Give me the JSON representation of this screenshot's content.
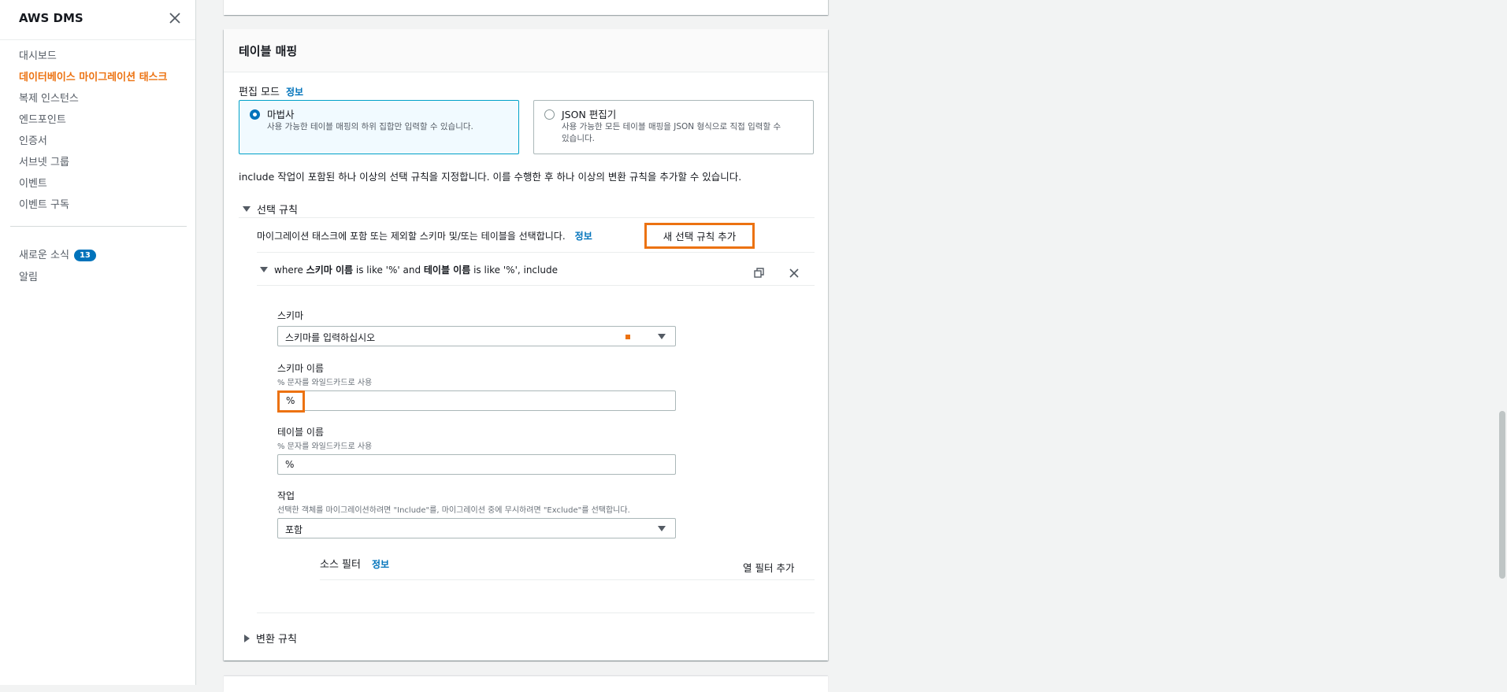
{
  "sidebar": {
    "title": "AWS DMS",
    "items": [
      {
        "label": "대시보드"
      },
      {
        "label": "데이터베이스 마이그레이션 태스크"
      },
      {
        "label": "복제 인스턴스"
      },
      {
        "label": "엔드포인트"
      },
      {
        "label": "인증서"
      },
      {
        "label": "서브넷 그룹"
      },
      {
        "label": "이벤트"
      },
      {
        "label": "이벤트 구독"
      }
    ],
    "whats_new": {
      "label": "새로운 소식",
      "count": "13"
    },
    "notifications": {
      "label": "알림"
    }
  },
  "panel": {
    "title": "테이블 매핑",
    "edit_mode": {
      "label": "편집 모드",
      "info": "정보"
    },
    "tiles": [
      {
        "label": "마법사",
        "desc": "사용 가능한 테이블 매핑의 하위 집합만 입력할 수 있습니다."
      },
      {
        "label": "JSON 편집기",
        "desc_line1": "사용 가능한 모든 테이블 매핑을 JSON 형식으로 직접 입력할 수",
        "desc_line2": "있습니다."
      }
    ],
    "instructions": "include 작업이 포함된 하나 이상의 선택 규칙을 지정합니다. 이를 수행한 후 하나 이상의 변환 규칙을 추가할 수 있습니다.",
    "selection_rules": {
      "title": "선택 규칙",
      "description": "마이그레이션 태스크에 포함 또는 제외할 스키마 및/또는 테이블을 선택합니다.",
      "info": "정보",
      "add_button": "새 선택 규칙 추가",
      "rule": {
        "summary_prefix": "where ",
        "schema_name_bold": "스키마 이름",
        "summary_mid1": " is like '%' and ",
        "table_name_bold": "테이블 이름",
        "summary_mid2": " is like '%', include",
        "schema": {
          "label": "스키마",
          "value": "스키마를 입력하십시오"
        },
        "schema_name": {
          "label": "스키마 이름",
          "hint": "% 문자를 와일드카드로 사용",
          "value": "%"
        },
        "table_name": {
          "label": "테이블 이름",
          "hint": "% 문자를 와일드카드로 사용",
          "value": "%"
        },
        "action": {
          "label": "작업",
          "hint": "선택한 객체를 마이그레이션하려면 \"Include\"를, 마이그레이션 중에 무시하려면 \"Exclude\"를 선택합니다.",
          "value": "포함"
        },
        "source_filter": {
          "label": "소스 필터",
          "info": "정보",
          "add_column_filter": "열 필터 추가"
        }
      }
    },
    "transformation_rules": {
      "title": "변환 규칙"
    }
  },
  "colors": {
    "accent_orange": "#ec7211",
    "link_blue": "#0073bb",
    "selected_tile_border": "#00a1c9"
  }
}
